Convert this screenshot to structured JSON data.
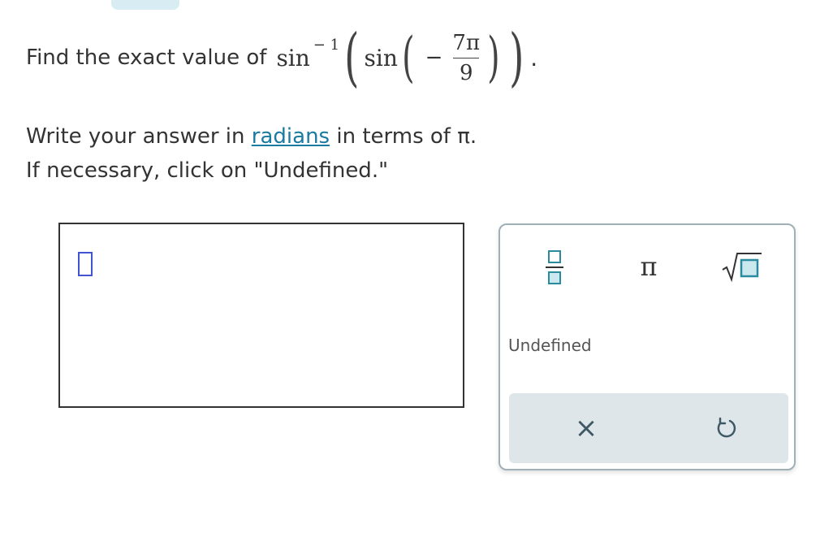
{
  "problem": {
    "prefix": "Find the exact value of",
    "outer_func": "sin",
    "outer_exponent": "− 1",
    "inner_func": "sin",
    "minus_sign": "−",
    "numerator": "7π",
    "denominator": "9",
    "period": "."
  },
  "instructions": {
    "line1_prefix": "Write your answer in",
    "line1_link": "radians",
    "line1_suffix": "in terms of π.",
    "line2": "If necessary, click on \"Undefined.\""
  },
  "keypad": {
    "pi_label": "π",
    "undefined_label": "Undefined",
    "clear_label": "×",
    "accent_color": "#2a8a9e"
  }
}
